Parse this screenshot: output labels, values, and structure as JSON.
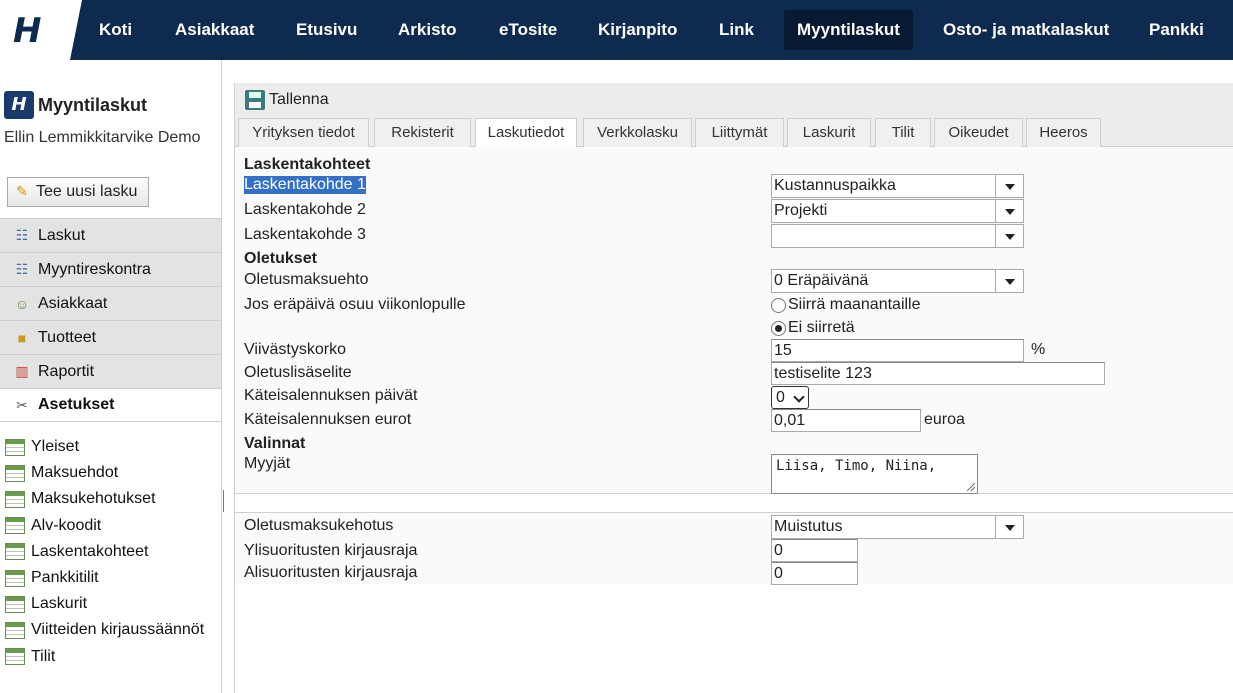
{
  "topnav": {
    "logo": "H",
    "items": [
      "Koti",
      "Asiakkaat",
      "Etusivu",
      "Arkisto",
      "eTosite",
      "Kirjanpito",
      "Link",
      "Myyntilaskut",
      "Osto- ja matkalaskut",
      "Pankki"
    ],
    "active": "Myyntilaskut"
  },
  "sidebar": {
    "app_logo": "H",
    "app_name": "Myyntilaskut",
    "company": "Ellin Lemmikkitarvike Demo",
    "new_invoice_label": "Tee uusi lasku",
    "menu": [
      "Laskut",
      "Myyntireskontra",
      "Asiakkaat",
      "Tuotteet",
      "Raportit",
      "Asetukset"
    ],
    "active": "Asetukset",
    "submenu": [
      "Yleiset",
      "Maksuehdot",
      "Maksukehotukset",
      "Alv-koodit",
      "Laskentakohteet",
      "Pankkitilit",
      "Laskurit",
      "Viitteiden kirjaussäännöt",
      "Tilit"
    ]
  },
  "toolbar": {
    "save_label": "Tallenna"
  },
  "tabs": [
    "Yrityksen tiedot",
    "Rekisterit",
    "Laskutiedot",
    "Verkkolasku",
    "Liittymät",
    "Laskurit",
    "Tilit",
    "Oikeudet",
    "Heeros"
  ],
  "active_tab": "Laskutiedot",
  "form": {
    "section_laskentakohteet": "Laskentakohteet",
    "lk1_label": "Laskentakohde 1",
    "lk1_value": "Kustannuspaikka",
    "lk2_label": "Laskentakohde 2",
    "lk2_value": "Projekti",
    "lk3_label": "Laskentakohde 3",
    "lk3_value": "",
    "section_oletukset": "Oletukset",
    "maksuehto_label": "Oletusmaksuehto",
    "maksuehto_value": "0 Eräpäivänä",
    "viikonloppu_label": "Jos eräpäivä osuu viikonlopulle",
    "radio_siirra": "Siirrä maanantaille",
    "radio_ei_siirreta": "Ei siirretä",
    "radio_selected": "Ei siirretä",
    "viivastyskorko_label": "Viivästyskorko",
    "viivastyskorko_value": "15",
    "viivastyskorko_unit": "%",
    "lisaselite_label": "Oletuslisäselite",
    "lisaselite_value": "testiselite 123",
    "kateis_paivat_label": "Käteisalennuksen päivät",
    "kateis_paivat_value": "0",
    "kateis_eurot_label": "Käteisalennuksen eurot",
    "kateis_eurot_value": "0,01",
    "kateis_eurot_unit": "euroa",
    "section_valinnat": "Valinnat",
    "myyjat_label": "Myyjät",
    "myyjat_value": "Liisa, Timo, Niina,",
    "maksukehotus_label": "Oletusmaksukehotus",
    "maksukehotus_value": "Muistutus",
    "ylisuoritus_label": "Ylisuoritusten kirjausraja",
    "ylisuoritus_value": "0",
    "alisuoritus_label": "Alisuoritusten kirjausraja",
    "alisuoritus_value": "0"
  },
  "colors": {
    "nav_bg": "#0f2a4f",
    "nav_active": "#081a32",
    "selection": "#3470c8"
  }
}
